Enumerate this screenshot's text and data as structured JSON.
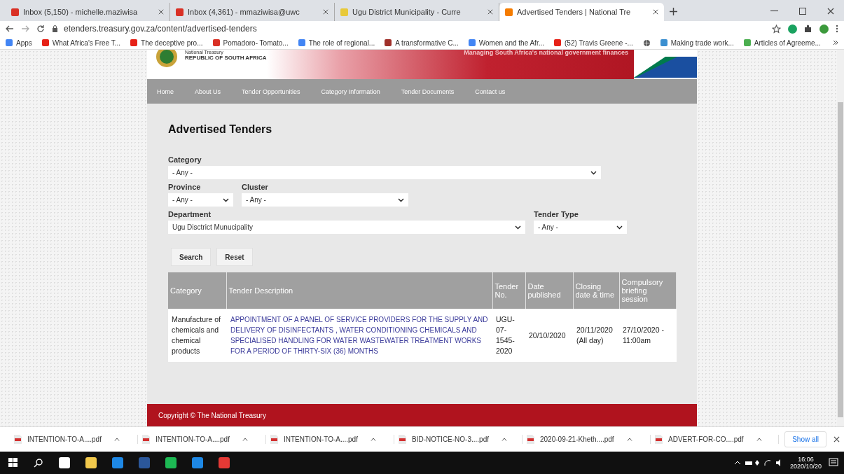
{
  "browser": {
    "tabs": [
      {
        "title": "Inbox (5,150) - michelle.maziwisa",
        "selected": false
      },
      {
        "title": "Inbox (4,361) - mmaziwisa@uwc",
        "selected": false
      },
      {
        "title": "Ugu District Municipality - Curre",
        "selected": false
      },
      {
        "title": "Advertised Tenders | National Tre",
        "selected": true
      }
    ],
    "address": "etenders.treasury.gov.za/content/advertised-tenders",
    "bookmarks": [
      "Apps",
      "What Africa's Free T...",
      "The deceptive pro...",
      "Pomadoro- Tomato...",
      "The role of regional...",
      "A transformative C...",
      "Women and the Afr...",
      "(52) Travis Greene -...",
      "Making trade work...",
      "Articles of Agreeme..."
    ]
  },
  "site": {
    "org_small": "National Treasury",
    "org": "REPUBLIC OF SOUTH AFRICA",
    "tagline": "Managing South Africa's national government finances",
    "nav": [
      "Home",
      "About Us",
      "Tender Opportunities",
      "Category Information",
      "Tender Documents",
      "Contact us"
    ],
    "footer": "Copyright © The National Treasury"
  },
  "page_title": "Advertised Tenders",
  "filters": {
    "category": {
      "label": "Category",
      "value": "- Any -"
    },
    "province": {
      "label": "Province",
      "value": "- Any -"
    },
    "cluster": {
      "label": "Cluster",
      "value": "- Any -"
    },
    "department": {
      "label": "Department",
      "value": "Ugu Disctrict Munucipality"
    },
    "tender_type": {
      "label": "Tender Type",
      "value": "- Any -"
    }
  },
  "buttons": [
    "Search",
    "Reset"
  ],
  "table": {
    "columns": [
      "Category",
      "Tender Description",
      "Tender No.",
      "Date published",
      "Closing date & time",
      "Compulsory briefing session"
    ],
    "rows": [
      {
        "category": "Manufacture of chemicals and chemical products",
        "description": "APPOINTMENT OF A PANEL OF SERVICE PROVIDERS FOR THE SUPPLY AND DELIVERY OF DISINFECTANTS , WATER CONDITIONING CHEMICALS AND SPECIALISED HANDLING FOR WATER WASTEWATER TREATMENT WORKS FOR A PERIOD OF THIRTY-SIX (36) MONTHS",
        "tender_no": "UGU-07-1545-2020",
        "published": "20/10/2020",
        "closing": "20/11/2020 (All day)",
        "briefing": "27/10/2020 - 11:00am"
      }
    ]
  },
  "downloads": [
    "INTENTION-TO-A....pdf",
    "INTENTION-TO-A....pdf",
    "INTENTION-TO-A....pdf",
    "BID-NOTICE-NO-3....pdf",
    "2020-09-21-Kheth....pdf",
    "ADVERT-FOR-CO....pdf"
  ],
  "show_all": "Show all",
  "taskbar": {
    "time": "16:06",
    "date": "2020/10/20"
  }
}
